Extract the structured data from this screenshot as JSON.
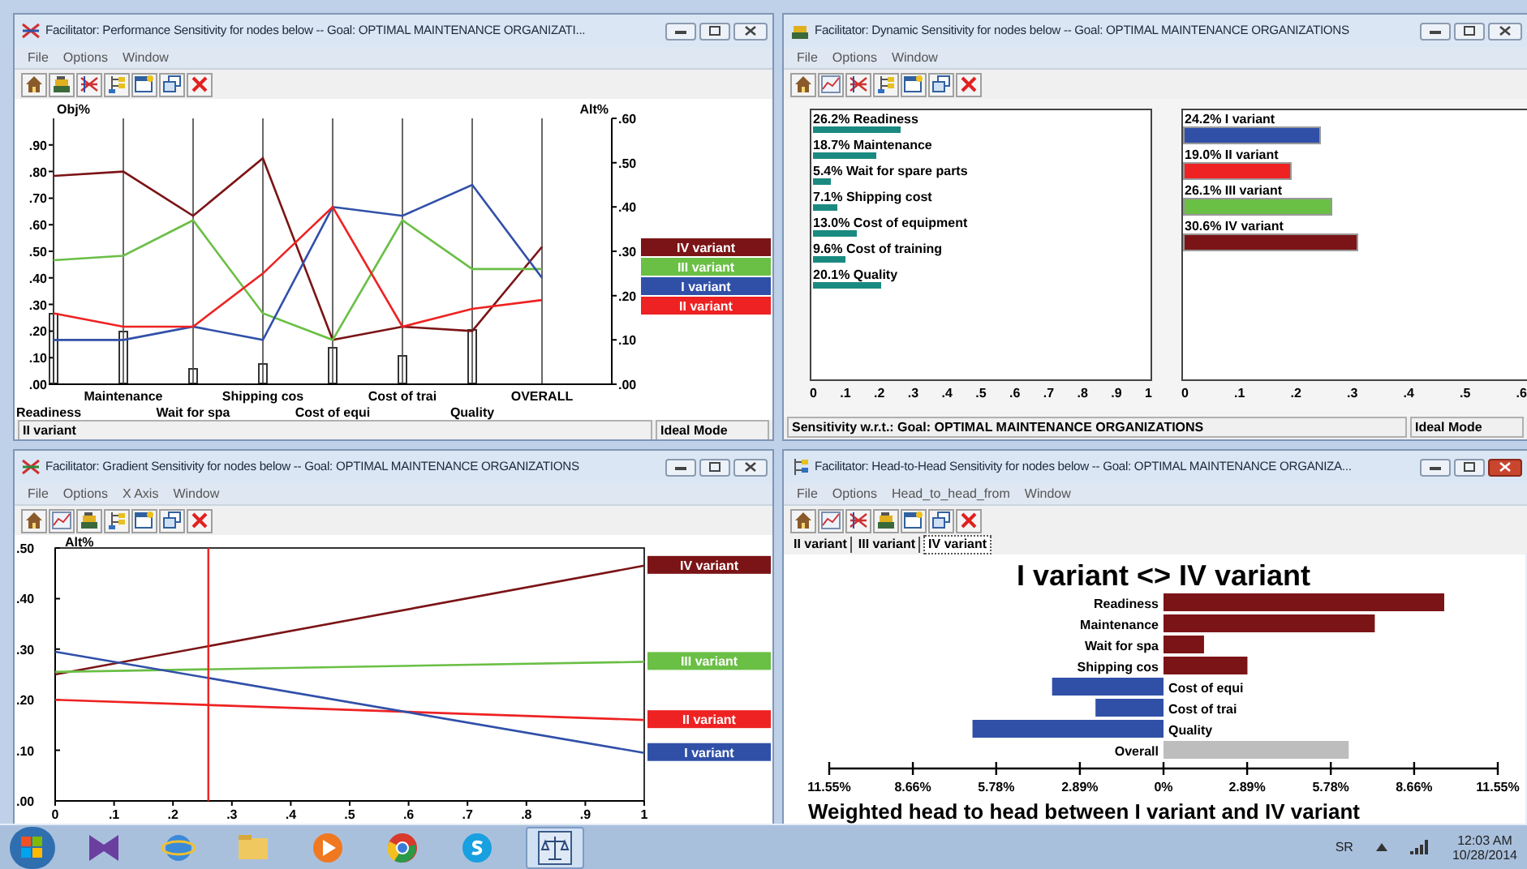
{
  "performance_window": {
    "title": "Facilitator: Performance Sensitivity for nodes below -- Goal: OPTIMAL MAINTENANCE ORGANIZATI...",
    "active": false,
    "menu": [
      "File",
      "Options",
      "Window"
    ],
    "obj_axis": {
      "label": "Obj%",
      "ticks": [
        ".90",
        ".80",
        ".70",
        ".60",
        ".50",
        ".40",
        ".30",
        ".20",
        ".10",
        ".00"
      ]
    },
    "objective_weights": [
      {
        "level": 0.27
      },
      {
        "level": 0.2
      },
      {
        "level": 0.06
      },
      {
        "level": 0.08
      },
      {
        "level": 0.14
      },
      {
        "level": 0.11
      },
      {
        "level": 0.21
      }
    ],
    "chart_data": {
      "type": "line",
      "ylabel": "Alt%",
      "grid": true,
      "categories": [
        "Readiness",
        "Maintenance",
        "Wait for spa",
        "Shipping cos",
        "Cost of equi",
        "Cost of trai",
        "Quality",
        "OVERALL"
      ],
      "ylim": [
        0,
        0.6
      ],
      "yticks": [
        {
          "value": 0,
          "label": ".00"
        },
        {
          "value": 0.1,
          "label": ".10"
        },
        {
          "value": 0.2,
          "label": ".20"
        },
        {
          "value": 0.3,
          "label": ".30"
        },
        {
          "value": 0.4,
          "label": ".40"
        },
        {
          "value": 0.5,
          "label": ".50"
        },
        {
          "value": 0.6,
          "label": ".60"
        }
      ],
      "series": [
        {
          "name": "IV variant",
          "color": "#7b1416",
          "values": [
            0.47,
            0.48,
            0.38,
            0.51,
            0.1,
            0.13,
            0.12,
            0.31
          ]
        },
        {
          "name": "III variant",
          "color": "#6abf45",
          "values": [
            0.28,
            0.29,
            0.37,
            0.16,
            0.1,
            0.37,
            0.26,
            0.26
          ]
        },
        {
          "name": "I variant",
          "color": "#3050a8",
          "values": [
            0.1,
            0.1,
            0.13,
            0.1,
            0.4,
            0.38,
            0.45,
            0.24
          ]
        },
        {
          "name": "II variant",
          "color": "#ee2222",
          "values": [
            0.16,
            0.13,
            0.13,
            0.25,
            0.4,
            0.13,
            0.17,
            0.19
          ]
        }
      ]
    },
    "status": "II variant",
    "mode": "Ideal Mode"
  },
  "dynamic_window": {
    "title": "Facilitator: Dynamic Sensitivity for nodes below -- Goal: OPTIMAL MAINTENANCE ORGANIZATIONS",
    "active": false,
    "menu": [
      "File",
      "Options",
      "Window"
    ],
    "objectives": [
      {
        "label": "26.2% Readiness",
        "level": 0.262
      },
      {
        "label": "18.7% Maintenance",
        "level": 0.187
      },
      {
        "label": "5.4% Wait for spare parts",
        "level": 0.054
      },
      {
        "label": "7.1% Shipping cost",
        "level": 0.071
      },
      {
        "label": "13.0% Cost of equipment",
        "level": 0.13
      },
      {
        "label": "9.6% Cost of training",
        "level": 0.096
      },
      {
        "label": "20.1% Quality",
        "level": 0.201
      }
    ],
    "objective_axis": [
      "0",
      ".1",
      ".2",
      ".3",
      ".4",
      ".5",
      ".6",
      ".7",
      ".8",
      ".9",
      "1"
    ],
    "alternatives": [
      {
        "label": "24.2% I variant",
        "level": 0.403,
        "color": "#3050a8"
      },
      {
        "label": "19.0% II variant",
        "level": 0.317,
        "color": "#ee2222"
      },
      {
        "label": "26.1% III variant",
        "level": 0.435,
        "color": "#6abf45"
      },
      {
        "label": "30.6% IV variant",
        "level": 0.51,
        "color": "#7b1416"
      }
    ],
    "alternative_axis": [
      "0",
      ".1",
      ".2",
      ".3",
      ".4",
      ".5",
      ".6"
    ],
    "status": "Sensitivity w.r.t.: Goal: OPTIMAL MAINTENANCE ORGANIZATIONS",
    "mode": "Ideal Mode"
  },
  "gradient_window": {
    "title": "Facilitator: Gradient Sensitivity for nodes below -- Goal: OPTIMAL MAINTENANCE ORGANIZATIONS",
    "active": false,
    "menu": [
      "File",
      "Options",
      "X Axis",
      "Window"
    ],
    "chart_data": {
      "type": "line",
      "ylabel": "Alt%",
      "x": [
        0,
        1
      ],
      "xlim": [
        0,
        1
      ],
      "ylim": [
        0,
        0.5
      ],
      "xticks": [
        {
          "value": 0,
          "label": "0"
        },
        {
          "value": 0.1,
          "label": ".1"
        },
        {
          "value": 0.2,
          "label": ".2"
        },
        {
          "value": 0.3,
          "label": ".3"
        },
        {
          "value": 0.4,
          "label": ".4"
        },
        {
          "value": 0.5,
          "label": ".5"
        },
        {
          "value": 0.6,
          "label": ".6"
        },
        {
          "value": 0.7,
          "label": ".7"
        },
        {
          "value": 0.8,
          "label": ".8"
        },
        {
          "value": 0.9,
          "label": ".9"
        },
        {
          "value": 1,
          "label": "1"
        }
      ],
      "yticks": [
        {
          "value": 0,
          "label": ".00"
        },
        {
          "value": 0.1,
          "label": ".10"
        },
        {
          "value": 0.2,
          "label": ".20"
        },
        {
          "value": 0.3,
          "label": ".30"
        },
        {
          "value": 0.4,
          "label": ".40"
        },
        {
          "value": 0.5,
          "label": ".50"
        }
      ],
      "series": [
        {
          "name": "IV variant",
          "color": "#7b1416",
          "values": [
            0.25,
            0.465
          ]
        },
        {
          "name": "III variant",
          "color": "#6abf45",
          "values": [
            0.255,
            0.275
          ]
        },
        {
          "name": "II variant",
          "color": "#ee2222",
          "values": [
            0.2,
            0.16
          ]
        },
        {
          "name": "I variant",
          "color": "#3050a8",
          "values": [
            0.295,
            0.095
          ]
        }
      ],
      "ref_lines": [
        {
          "axis": "x",
          "value": 0.26
        }
      ]
    }
  },
  "head_to_head_window": {
    "title": "Facilitator: Head-to-Head Sensitivity for nodes below --  Goal: OPTIMAL MAINTENANCE ORGANIZA...",
    "active": true,
    "menu": [
      "File",
      "Options",
      "Head_to_head_from",
      "Window"
    ],
    "tabs": [
      {
        "label": "II variant",
        "selected": false
      },
      {
        "label": "III variant",
        "selected": false
      },
      {
        "label": "IV variant",
        "selected": true
      }
    ],
    "chart_data": {
      "type": "bar",
      "orientation": "horizontal",
      "title": "I variant <> IV variant",
      "xlabel": "Weighted head to head between I variant and IV variant",
      "categories": [
        "Readiness",
        "Maintenance",
        "Wait for spa",
        "Shipping cos",
        "Cost of equi",
        "Cost of trai",
        "Quality",
        "Overall"
      ],
      "xlim": [
        -11.55,
        11.55
      ],
      "xticks": [
        {
          "value": -11.55,
          "label": "11.55%"
        },
        {
          "value": -8.66,
          "label": "8.66%"
        },
        {
          "value": -5.78,
          "label": "5.78%"
        },
        {
          "value": -2.89,
          "label": "2.89%"
        },
        {
          "value": 0,
          "label": "0%"
        },
        {
          "value": 2.89,
          "label": "2.89%"
        },
        {
          "value": 5.78,
          "label": "5.78%"
        },
        {
          "value": 8.66,
          "label": "8.66%"
        },
        {
          "value": 11.55,
          "label": "11.55%"
        }
      ],
      "series": [
        {
          "color": "#7b1416",
          "values": [
            9.7,
            7.3,
            1.4,
            2.9,
            null,
            null,
            null,
            null
          ]
        },
        {
          "color": "#3050a8",
          "values": [
            null,
            null,
            null,
            null,
            -3.85,
            -2.35,
            -6.6,
            null
          ]
        },
        {
          "color": "#bdbdbd",
          "values": [
            null,
            null,
            null,
            null,
            null,
            null,
            null,
            6.4
          ]
        }
      ]
    }
  },
  "taskbar": {
    "language": "SR",
    "time": "12:03 AM",
    "date": "10/28/2014"
  }
}
